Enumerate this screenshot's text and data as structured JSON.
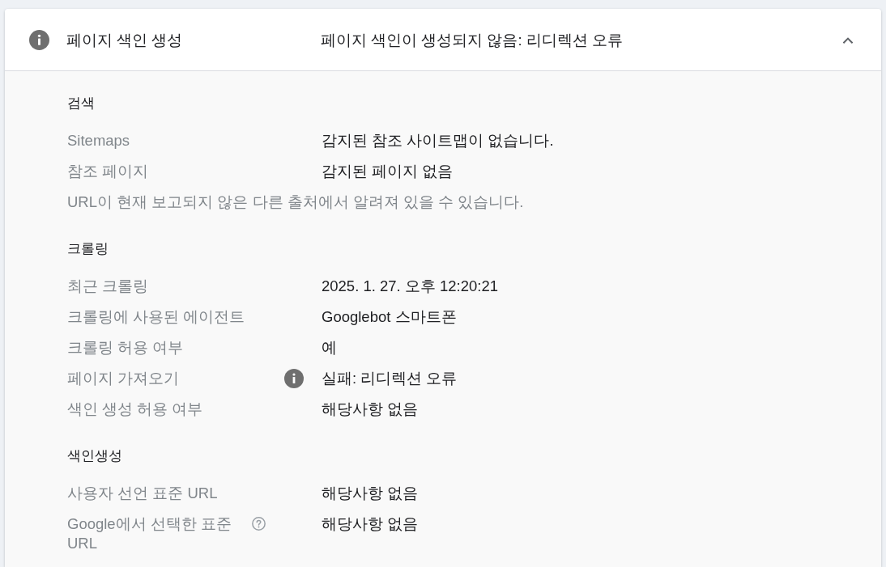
{
  "panel": {
    "title": "페이지 색인 생성",
    "status": "페이지 색인이 생성되지 않음: 리디렉션 오류",
    "expanded": true
  },
  "sections": [
    {
      "heading": "검색",
      "rows": [
        {
          "kind": "field",
          "label": "Sitemaps",
          "value": "감지된 참조 사이트맵이 없습니다."
        },
        {
          "kind": "field",
          "label": "참조 페이지",
          "value": "감지된 페이지 없음"
        },
        {
          "kind": "note",
          "text": "URL이 현재 보고되지 않은 다른 출처에서 알려져 있을 수 있습니다."
        }
      ]
    },
    {
      "heading": "크롤링",
      "rows": [
        {
          "kind": "field",
          "label": "최근 크롤링",
          "value": "2025. 1. 27. 오후 12:20:21"
        },
        {
          "kind": "field",
          "label": "크롤링에 사용된 에이전트",
          "value": "Googlebot 스마트폰"
        },
        {
          "kind": "field",
          "label": "크롤링 허용 여부",
          "value": "예"
        },
        {
          "kind": "info",
          "label": "페이지 가져오기",
          "value": "실패: 리디렉션 오류"
        },
        {
          "kind": "field",
          "label": "색인 생성 허용 여부",
          "value": "해당사항 없음"
        }
      ]
    },
    {
      "heading": "색인생성",
      "rows": [
        {
          "kind": "field",
          "label": "사용자 선언 표준 URL",
          "value": "해당사항 없음"
        },
        {
          "kind": "help",
          "label": "Google에서 선택한 표준 URL",
          "value": "해당사항 없음"
        }
      ]
    }
  ]
}
